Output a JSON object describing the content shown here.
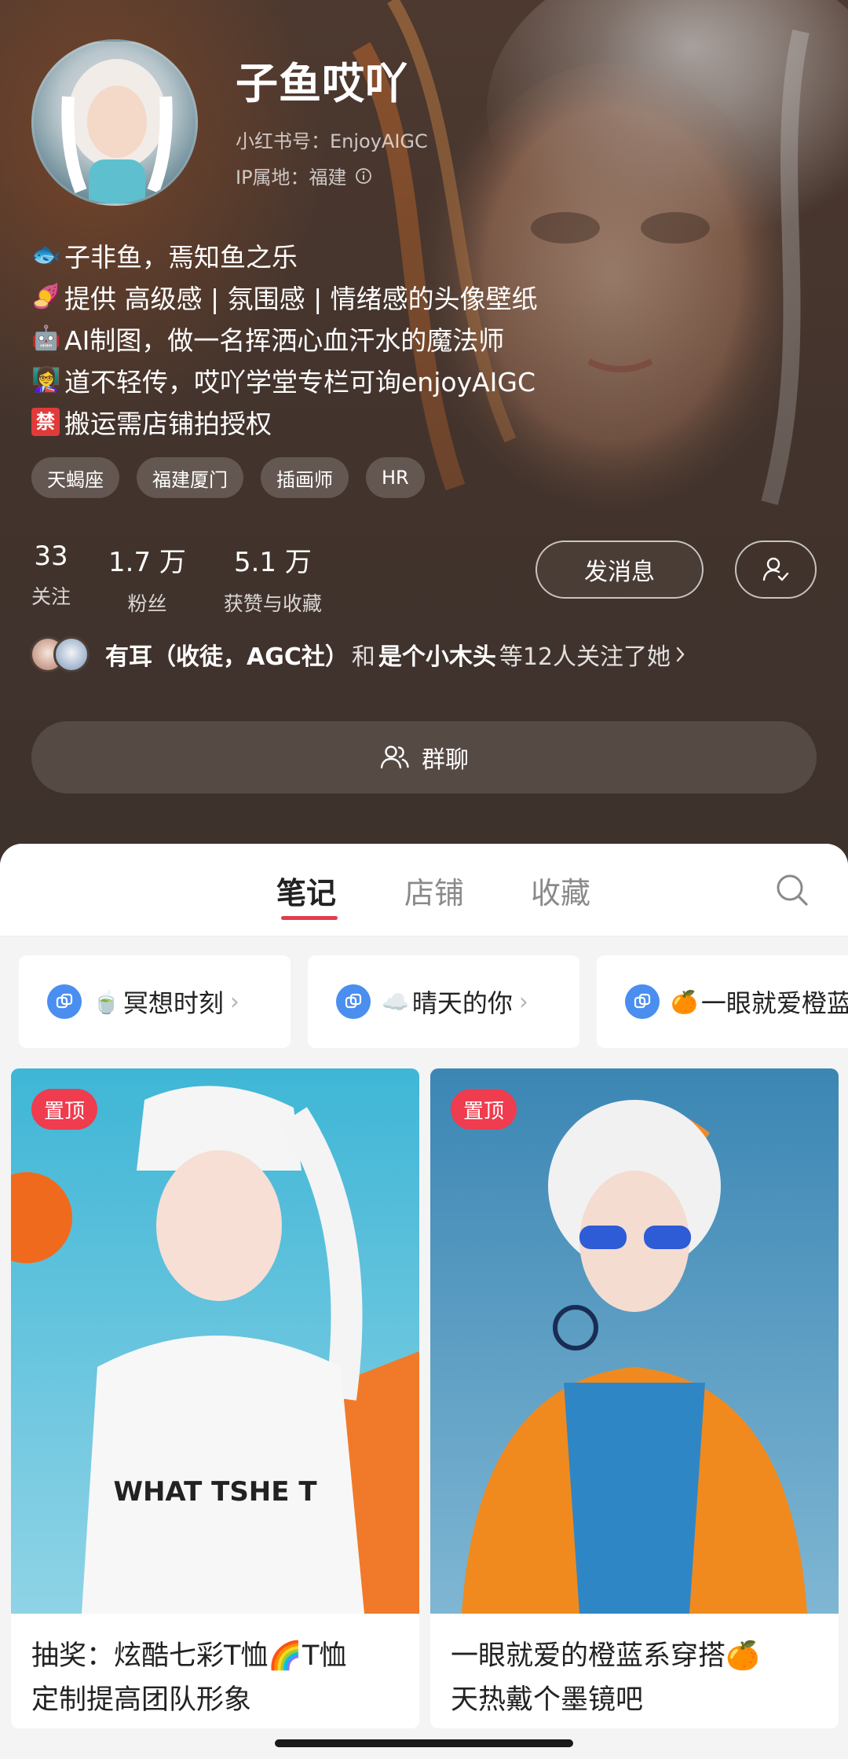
{
  "profile": {
    "name": "子鱼哎吖",
    "id_line": "小红书号：EnjoyAIGC",
    "ip_line": "IP属地：福建",
    "bio": [
      {
        "emoji": "🐟",
        "text": "子非鱼，焉知鱼之乐"
      },
      {
        "emoji": "🍠",
        "text": "提供 高级感 | 氛围感 | 情绪感的头像壁纸"
      },
      {
        "emoji": "🤖",
        "text": "AI制图，做一名挥洒心血汗水的魔法师"
      },
      {
        "emoji": "👩‍🏫",
        "text": "道不轻传，哎吖学堂专栏可询enjoyAIGC"
      },
      {
        "emoji": "禁",
        "text": "搬运需店铺拍授权"
      }
    ],
    "tags": [
      "天蝎座",
      "福建厦门",
      "插画师",
      "HR"
    ],
    "stats": [
      {
        "value": "33",
        "label": "关注"
      },
      {
        "value": "1.7 万",
        "label": "粉丝"
      },
      {
        "value": "5.1 万",
        "label": "获赞与收藏"
      }
    ],
    "message_button": "发消息",
    "mutual": {
      "user1": "有耳（收徒，AGC社）",
      "connector": "和",
      "user2": "是个小木头",
      "suffix": "等12人关注了她"
    },
    "group_chat_button": "群聊"
  },
  "tabs": [
    {
      "label": "笔记",
      "active": true
    },
    {
      "label": "店铺",
      "active": false
    },
    {
      "label": "收藏",
      "active": false
    }
  ],
  "collections": [
    {
      "emoji": "🍵",
      "label": "冥想时刻"
    },
    {
      "emoji": "☁️",
      "label": "晴天的你"
    },
    {
      "emoji": "🍊",
      "label": "一眼就爱橙蓝"
    }
  ],
  "notes": [
    {
      "badge": "置顶",
      "title_line1": "抽奖：炫酷七彩T恤🌈T恤",
      "title_line2": "定制提高团队形象",
      "image_text": "WHAT TSHE T"
    },
    {
      "badge": "置顶",
      "title_line1": "一眼就爱的橙蓝系穿搭🍊",
      "title_line2": "天热戴个墨镜吧"
    }
  ],
  "colors": {
    "accent": "#e23c4d",
    "pin_badge": "#ef3c4e",
    "collection_icon": "#4a8ef0"
  }
}
